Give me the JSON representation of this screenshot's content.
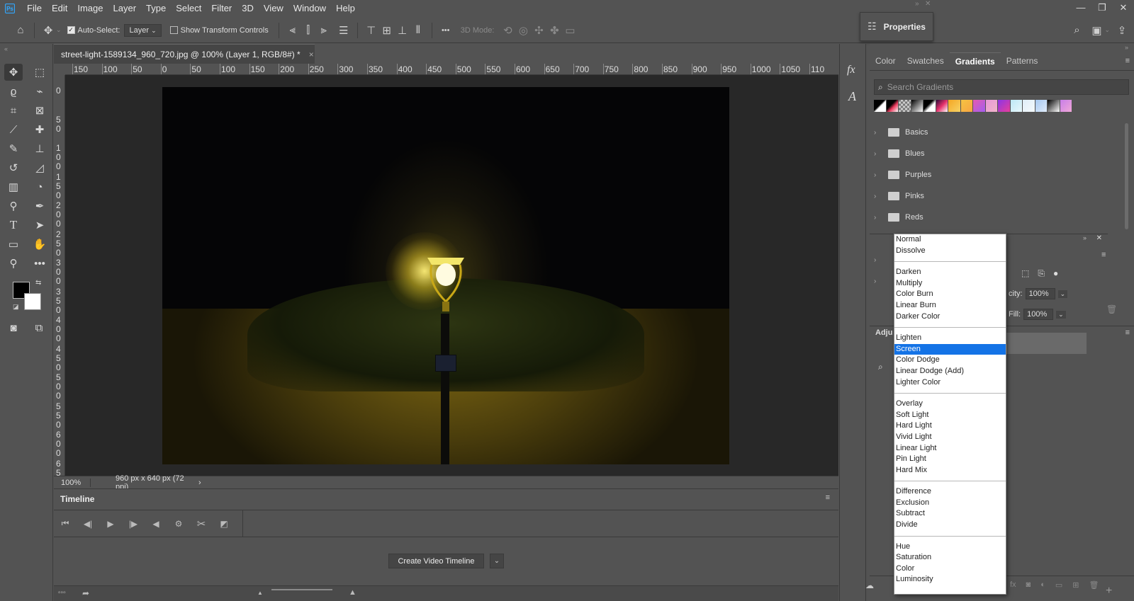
{
  "app": {
    "logo_text": "Ps"
  },
  "menubar": {
    "items": [
      "File",
      "Edit",
      "Image",
      "Layer",
      "Type",
      "Select",
      "Filter",
      "3D",
      "View",
      "Window",
      "Help"
    ]
  },
  "window_controls": {
    "minimize": "—",
    "restore": "❐",
    "close": "✕"
  },
  "options_bar": {
    "auto_select_label": "Auto-Select:",
    "auto_select_value": "Layer",
    "show_transform_label": "Show Transform Controls",
    "three_d_mode_label": "3D Mode:",
    "more_label": "•••"
  },
  "properties_popup": {
    "label": "Properties"
  },
  "document": {
    "tab_title": "street-light-1589134_960_720.jpg @ 100% (Layer 1, RGB/8#) *",
    "close_symbol": "×"
  },
  "ruler": {
    "top_ticks": [
      "150",
      "100",
      "50",
      "0",
      "50",
      "100",
      "150",
      "200",
      "250",
      "300",
      "350",
      "400",
      "450",
      "500",
      "550",
      "600",
      "650",
      "700",
      "750",
      "800",
      "850",
      "900",
      "950",
      "1000",
      "1050",
      "110"
    ],
    "left_ticks": [
      "0",
      "5\n0",
      "1\n0\n0",
      "1\n5\n0",
      "2\n0\n0",
      "2\n5\n0",
      "3\n0\n0",
      "3\n5\n0",
      "4\n0\n0",
      "4\n5\n0",
      "5\n0\n0",
      "5\n5\n0",
      "6\n0\n0",
      "6\n5\n0"
    ]
  },
  "status": {
    "zoom": "100%",
    "dimensions": "960 px x 640 px (72 ppi)",
    "arrow": "›"
  },
  "timeline": {
    "tab_label": "Timeline",
    "create_button": "Create Video Timeline",
    "dropdown_arrow": "⌄"
  },
  "right_panel": {
    "tabs": [
      "Color",
      "Swatches",
      "Gradients",
      "Patterns"
    ],
    "active_tab": "Gradients",
    "search_placeholder": "Search Gradients",
    "gradient_colors": [
      "linear-gradient(135deg,#000 45%,#fff 55%)",
      "linear-gradient(135deg,#000 40%,#e8375a 60%,#fff)",
      "repeating-conic-gradient(#ccc 0 25%,#777 0 50%) 0/6px 6px",
      "linear-gradient(135deg,#000,#fff)",
      "linear-gradient(135deg,#000 40%,#fff 60%)",
      "linear-gradient(135deg,#2a0a3a,#e6306b,#fff)",
      "linear-gradient(135deg,#f5a623,#f6d365)",
      "linear-gradient(135deg,#f6c343,#f7a541)",
      "linear-gradient(135deg,#e55bb0,#a35cf0)",
      "linear-gradient(135deg,#e898d8,#f0b4c8)",
      "linear-gradient(135deg,#8b35e6,#e83f9a)",
      "linear-gradient(135deg,#bde8f5,#e8f7fb)",
      "linear-gradient(135deg,#dfeef8,#f5fafc)",
      "linear-gradient(135deg,#a6c8f0,#e0ecfa)",
      "linear-gradient(135deg,#000,#fff)",
      "linear-gradient(135deg,#c87ee8,#f0a8d8)"
    ],
    "folders": [
      "Basics",
      "Blues",
      "Purples",
      "Pinks",
      "Reds"
    ],
    "layers_opacity_label": "city:",
    "layers_opacity_value": "100%",
    "layers_fill_label": "Fill:",
    "layers_fill_value": "100%",
    "adjustments_label": "Adju"
  },
  "blend_modes": {
    "groups": [
      [
        "Normal",
        "Dissolve"
      ],
      [
        "Darken",
        "Multiply",
        "Color Burn",
        "Linear Burn",
        "Darker Color"
      ],
      [
        "Lighten",
        "Screen",
        "Color Dodge",
        "Linear Dodge (Add)",
        "Lighter Color"
      ],
      [
        "Overlay",
        "Soft Light",
        "Hard Light",
        "Vivid Light",
        "Linear Light",
        "Pin Light",
        "Hard Mix"
      ],
      [
        "Difference",
        "Exclusion",
        "Subtract",
        "Divide"
      ],
      [
        "Hue",
        "Saturation",
        "Color",
        "Luminosity"
      ]
    ],
    "selected": "Screen"
  },
  "colors": {
    "ui_bg": "#535353",
    "selection_blue": "#1473e6",
    "foreground_color": "#000000",
    "background_color": "#ffffff"
  }
}
